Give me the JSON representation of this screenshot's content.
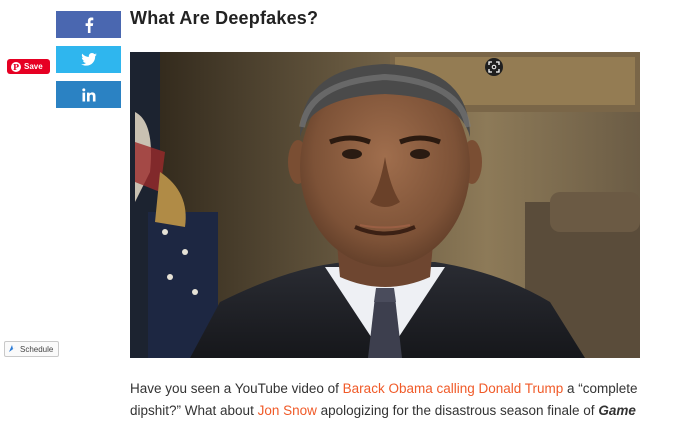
{
  "social": {
    "facebook_icon": "facebook-icon",
    "twitter_icon": "twitter-icon",
    "linkedin_icon": "linkedin-icon",
    "linkedin_label": "in",
    "facebook_label": "f"
  },
  "pinterest": {
    "label": "Save",
    "color": "#e60023"
  },
  "article": {
    "title": "What Are Deepfakes?",
    "video": {
      "description_icon": "expand-icon"
    },
    "paragraph": {
      "t1": "Have you seen a YouTube video of ",
      "link1": "Barack Obama calling Donald Trump",
      "t2": " a “complete dipshit?” What about ",
      "link2": "Jon Snow",
      "t3": " apologizing for the disastrous season finale of ",
      "em1": "Game"
    }
  },
  "schedule": {
    "label": "Schedule"
  },
  "colors": {
    "accent_link": "#f05a28",
    "facebook": "#4a67b0",
    "twitter": "#2fb6ee",
    "linkedin": "#2b82c3"
  }
}
